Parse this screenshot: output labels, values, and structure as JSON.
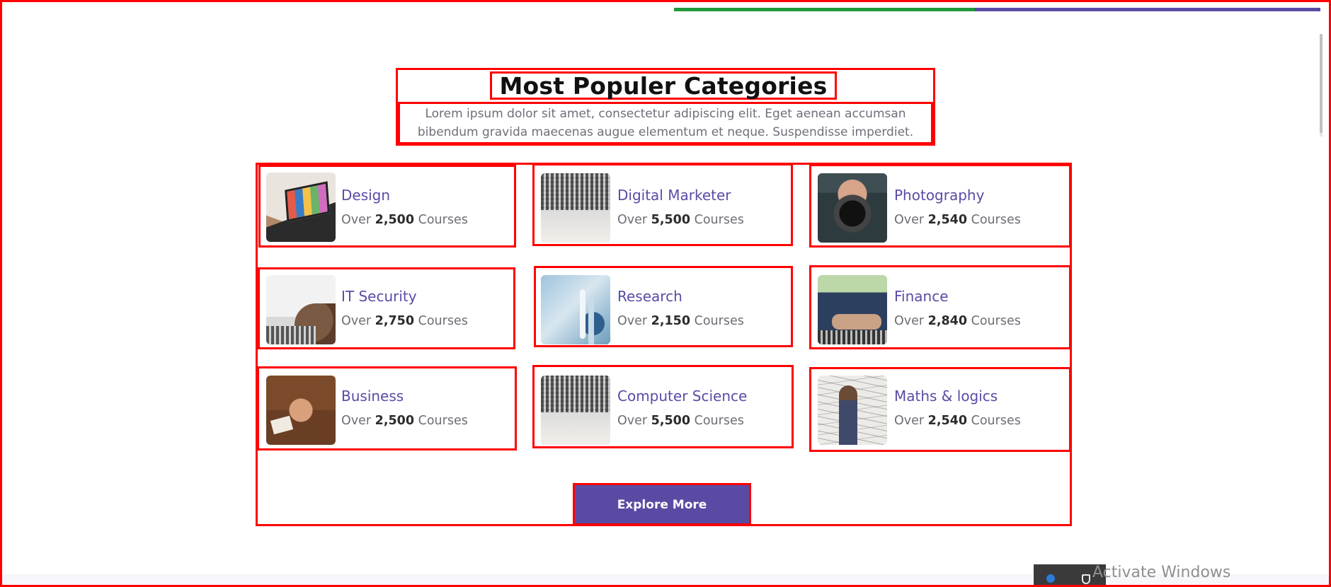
{
  "colors": {
    "accent": "#5b4aa4",
    "progress_green": "#1e9a3a",
    "annotation_red": "#ff0000",
    "title_text": "#111111",
    "body_text": "#6e6e7a"
  },
  "section": {
    "title": "Most Populer Categories",
    "description": "Lorem ipsum dolor sit amet, consectetur adipiscing elit. Eget aenean accumsan bibendum gravida maecenas augue elementum et neque. Suspendisse imperdiet."
  },
  "categories": [
    {
      "title": "Design",
      "prefix": "Over",
      "count": "2,500",
      "suffix": "Courses",
      "thumb": "design-photo"
    },
    {
      "title": "Digital Marketer",
      "prefix": "Over",
      "count": "5,500",
      "suffix": "Courses",
      "thumb": "laptop-photo"
    },
    {
      "title": "Photography",
      "prefix": "Over",
      "count": "2,540",
      "suffix": "Courses",
      "thumb": "photographer-photo"
    },
    {
      "title": "IT Security",
      "prefix": "Over",
      "count": "2,750",
      "suffix": "Courses",
      "thumb": "it-security-photo"
    },
    {
      "title": "Research",
      "prefix": "Over",
      "count": "2,150",
      "suffix": "Courses",
      "thumb": "research-photo"
    },
    {
      "title": "Finance",
      "prefix": "Over",
      "count": "2,840",
      "suffix": "Courses",
      "thumb": "finance-photo"
    },
    {
      "title": "Business",
      "prefix": "Over",
      "count": "2,500",
      "suffix": "Courses",
      "thumb": "business-photo"
    },
    {
      "title": "Computer Science",
      "prefix": "Over",
      "count": "5,500",
      "suffix": "Courses",
      "thumb": "laptop-photo"
    },
    {
      "title": "Maths & logics",
      "prefix": "Over",
      "count": "2,540",
      "suffix": "Courses",
      "thumb": "maths-photo"
    }
  ],
  "explore_button": {
    "label": "Explore More"
  },
  "watermark": {
    "text": "Activate Windows"
  }
}
